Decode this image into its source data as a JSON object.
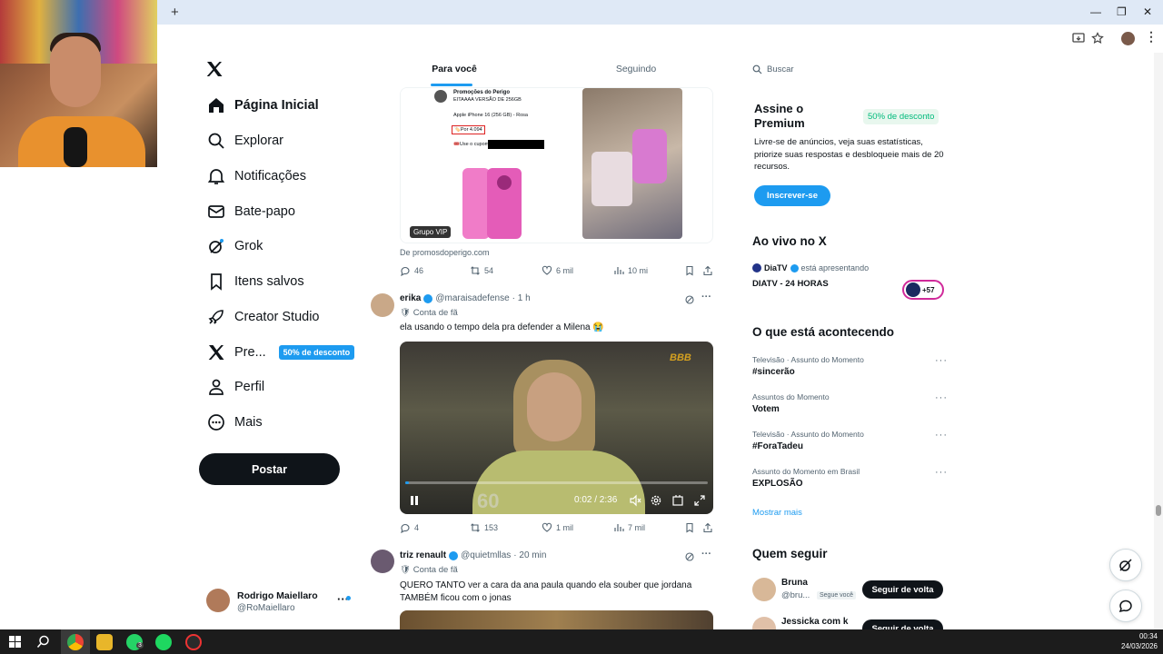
{
  "browser": {
    "new_tab_symbol": "+",
    "window_controls": [
      "—",
      "❐",
      "✕"
    ]
  },
  "left_nav": {
    "items": [
      {
        "label": "Página Inicial",
        "icon": "home-icon",
        "active": true
      },
      {
        "label": "Explorar",
        "icon": "search-icon"
      },
      {
        "label": "Notificações",
        "icon": "bell-icon"
      },
      {
        "label": "Bate-papo",
        "icon": "mail-icon"
      },
      {
        "label": "Grok",
        "icon": "grok-icon"
      },
      {
        "label": "Itens salvos",
        "icon": "bookmark-icon"
      },
      {
        "label": "Creator Studio",
        "icon": "rocket-icon"
      },
      {
        "label": "Pre...",
        "icon": "x-logo-icon",
        "badge": "50% de desconto"
      },
      {
        "label": "Perfil",
        "icon": "person-icon"
      },
      {
        "label": "Mais",
        "icon": "more-circle-icon"
      }
    ],
    "post_button": "Postar",
    "profile": {
      "name": "Rodrigo Maiellaro",
      "handle": "@RoMaiellaro"
    }
  },
  "feed": {
    "tabs": [
      "Para você",
      "Seguindo"
    ],
    "tweet1": {
      "embed_header": "Promoções do Perigo",
      "embed_line1": "EITAAAA VERSÃO DE 256GB",
      "embed_line2": "Apple iPhone 16 (256 GB) - Rosa",
      "embed_price": "🏷️Por 4.094",
      "embed_coupon": "🎟️Use o cupom:",
      "vip_badge": "Grupo VIP",
      "source": "De promosdoperigo.com",
      "replies": "46",
      "reposts": "54",
      "likes": "6 mil",
      "views": "10 mi"
    },
    "tweet2": {
      "name": "erika",
      "handle": "@maraisadefense",
      "time": "· 1 h",
      "tag": "Conta de fã",
      "text": "ela usando o tempo dela pra defender a Milena 😭",
      "video_time": "0:02 / 2:36",
      "video_progress": 0.013,
      "watermark": "BBB",
      "overlay_number": "60",
      "replies": "4",
      "reposts": "153",
      "likes": "1 mil",
      "views": "7 mil"
    },
    "tweet3": {
      "name": "triz renault",
      "handle": "@quietmllas",
      "time": "· 20 min",
      "tag": "Conta de fã",
      "text": "QUERO TANTO ver a cara da ana paula quando ela souber que jordana TAMBÉM ficou com o jonas"
    }
  },
  "right": {
    "search_placeholder": "Buscar",
    "premium": {
      "title": "Assine o Premium",
      "badge": "50% de desconto",
      "desc": "Livre-se de anúncios, veja suas estatísticas, priorize suas respostas e desbloqueie mais de 20 recursos.",
      "button": "Inscrever-se"
    },
    "live": {
      "title": "Ao vivo no X",
      "host": "DiaTV",
      "host_suffix": "está apresentando",
      "show": "DIATV - 24 HORAS",
      "count": "+57"
    },
    "trending": {
      "title": "O que está acontecendo",
      "items": [
        {
          "category": "Televisão · Assunto do Momento",
          "name": "#sincerão"
        },
        {
          "category": "Assuntos do Momento",
          "name": "Votem"
        },
        {
          "category": "Televisão · Assunto do Momento",
          "name": "#ForaTadeu"
        },
        {
          "category": "Assunto do Momento em Brasil",
          "name": "EXPLOSÃO"
        }
      ],
      "show_more": "Mostrar mais"
    },
    "who_to_follow": {
      "title": "Quem seguir",
      "users": [
        {
          "name": "Bruna",
          "handle": "@bru...",
          "note": "Segue você",
          "button": "Seguir de volta"
        },
        {
          "name": "Jessicka com k",
          "button": "Seguir de volta"
        }
      ]
    }
  },
  "taskbar": {
    "time": "00:34",
    "date": "24/03/2026",
    "whatsapp_badge": "3"
  },
  "colors": {
    "accent": "#1d9bf0",
    "text": "#0f1419",
    "muted": "#536471",
    "premium_badge_bg": "#e8f7ee",
    "premium_badge_text": "#00ba7c"
  }
}
